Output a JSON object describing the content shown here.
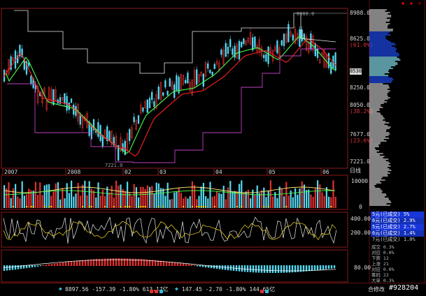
{
  "window_buttons": [
    "◆",
    "▪",
    "✕"
  ],
  "main_chart": {
    "price_ticks": [
      {
        "value": "8988.0",
        "pct": ""
      },
      {
        "value": "8625.0",
        "pct": "(61.0%)"
      },
      {
        "value": "8250.0",
        "pct": ""
      },
      {
        "value": "8050.0",
        "pct": "(38.2%)"
      },
      {
        "value": "7677.0",
        "pct": "(23.6%)"
      },
      {
        "value": "7221.0",
        "pct": ""
      }
    ],
    "current_price": "8530",
    "high_label": "8988.0",
    "low_label": "7221.0",
    "date_labels": [
      "2007",
      "2008",
      "02",
      "03",
      "04",
      "05",
      "06"
    ],
    "period": "日线"
  },
  "volume_panel": {
    "axis_top": "10000",
    "axis_bottom": "0"
  },
  "indicator_panel": {
    "axis_top": "400.00",
    "axis_mid": "200.00"
  },
  "macd_panel": {
    "axis_label": "80.00"
  },
  "legend_items": [
    "5元(已成交) 5%",
    "6元(已成交) 2.9%",
    "5元(已成交) 2.7%",
    "6元(已成交) 1.4%",
    "7元(已成交) 1.0%"
  ],
  "side_notes": [
    "成交 0.3%",
    "对应 0.0%",
    "下跌 12",
    "上涨 21",
    "对应 0.0%",
    "筹码 22",
    "大单 0.3%"
  ],
  "status_bar": {
    "left_values": "8897.56 -157.39 -1.80% 613.17亿",
    "mid_values": "147.45 -2.70 -1.80% 144.65亿",
    "right_label": "合修改",
    "code": "#928204"
  },
  "colors": {
    "background": "#000000",
    "frame": "#8b1a1a",
    "candle_up": "#e03030",
    "candle_down": "#55d8f0",
    "ma_red": "#ff2020",
    "ma_green": "#4cff4c",
    "channel": "#c040c0",
    "legend_bg": "#1836d8"
  }
}
